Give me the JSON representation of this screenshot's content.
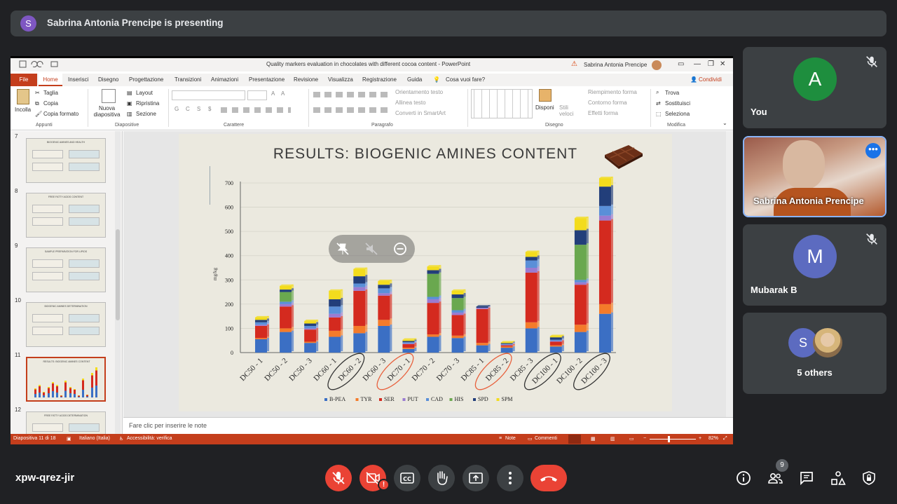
{
  "banner": {
    "avatar_letter": "S",
    "text": "Sabrina Antonia Prencipe is presenting"
  },
  "ppt": {
    "window_title": "Quality markers evaluation in chocolates with different cocoa content - PowerPoint",
    "user_name": "Sabrina Antonia Prencipe",
    "tabs": [
      "File",
      "Home",
      "Inserisci",
      "Disegno",
      "Progettazione",
      "Transizioni",
      "Animazioni",
      "Presentazione",
      "Revisione",
      "Visualizza",
      "Registrazione",
      "Guida"
    ],
    "tell_me": "Cosa vuoi fare?",
    "share": "Condividi",
    "ribbon": {
      "paste": "Incolla",
      "cut": "Taglia",
      "copy": "Copia",
      "format_painter": "Copia formato",
      "new_slide": "Nuova diapositiva",
      "layout": "Layout",
      "reset": "Ripristina",
      "section": "Sezione",
      "text_direction": "Orientamento testo",
      "align_text": "Allinea testo",
      "smartart": "Converti in SmartArt",
      "arrange": "Disponi",
      "quick_styles": "Stili veloci",
      "shape_fill": "Riempimento forma",
      "shape_outline": "Contorno forma",
      "shape_effects": "Effetti forma",
      "find": "Trova",
      "replace": "Sostituisci",
      "select": "Seleziona",
      "groups": {
        "clipboard": "Appunti",
        "slides": "Diapositive",
        "font": "Carattere",
        "paragraph": "Paragrafo",
        "drawing": "Disegno",
        "editing": "Modifica"
      },
      "font_buttons": [
        "G",
        "C",
        "S",
        "$"
      ]
    },
    "thumbnails": [
      {
        "num": "7",
        "title": "BIOGENIC AMINES AND HEALTH"
      },
      {
        "num": "8",
        "title": "FREE FATTY ACIDS CONTENT"
      },
      {
        "num": "9",
        "title": "SAMPLE PREPARATION FOR LIPIDS"
      },
      {
        "num": "10",
        "title": "BIOGENIC AMINES DETERMINATION"
      },
      {
        "num": "11",
        "title": "RESULTS: BIOGENIC AMINES CONTENT"
      },
      {
        "num": "12",
        "title": "FREE FATTY ACIDS DETERMINATION"
      }
    ],
    "notes_placeholder": "Fare clic per inserire le note",
    "status": {
      "slide": "Diapositiva 11 di 18",
      "language": "Italiano (Italia)",
      "accessibility": "Accessibilità: verifica",
      "notes": "Note",
      "comments": "Commenti",
      "zoom": "82%"
    }
  },
  "chart_data": {
    "type": "bar",
    "stacked": true,
    "title": "RESULTS: BIOGENIC AMINES CONTENT",
    "ylabel": "mg/kg",
    "ylim": [
      0,
      700
    ],
    "yticks": [
      0,
      100,
      200,
      300,
      400,
      500,
      600,
      700
    ],
    "categories": [
      "DC50 - 1",
      "DC50 - 2",
      "DC50 - 3",
      "DC60 - 1",
      "DC60 - 2",
      "DC60 - 3",
      "DC70 - 1",
      "DC70 - 2",
      "DC70 - 3",
      "DC85 - 1",
      "DC85 - 2",
      "DC85 - 3",
      "DC100 - 1",
      "DC100 - 2",
      "DC100 - 3"
    ],
    "circled": {
      "DC60 - 2": "#333333",
      "DC70 - 1": "#e8603c",
      "DC85 - 2": "#e8603c",
      "DC100 - 1": "#333333",
      "DC100 - 3": "#333333"
    },
    "series": [
      {
        "name": "B-PEA",
        "color": "#3b6fc4",
        "values": [
          55,
          85,
          40,
          65,
          80,
          110,
          15,
          65,
          60,
          30,
          20,
          100,
          25,
          85,
          160
        ]
      },
      {
        "name": "TYR",
        "color": "#f47b2a",
        "values": [
          5,
          15,
          5,
          25,
          30,
          25,
          5,
          10,
          10,
          10,
          5,
          25,
          5,
          30,
          40
        ]
      },
      {
        "name": "SER",
        "color": "#d42a1f",
        "values": [
          50,
          90,
          50,
          55,
          145,
          100,
          15,
          130,
          85,
          140,
          5,
          205,
          15,
          165,
          345
        ]
      },
      {
        "name": "PUT",
        "color": "#9a7bd1",
        "values": [
          5,
          10,
          5,
          15,
          15,
          10,
          3,
          15,
          10,
          5,
          3,
          20,
          3,
          10,
          20
        ]
      },
      {
        "name": "CAD",
        "color": "#5a8fd8",
        "values": [
          10,
          10,
          10,
          30,
          15,
          20,
          5,
          10,
          10,
          0,
          3,
          30,
          5,
          10,
          40
        ]
      },
      {
        "name": "HIS",
        "color": "#6aa84f",
        "values": [
          0,
          40,
          0,
          0,
          0,
          0,
          0,
          95,
          50,
          0,
          0,
          0,
          0,
          145,
          0
        ]
      },
      {
        "name": "SPD",
        "color": "#223e7a",
        "values": [
          10,
          10,
          10,
          30,
          30,
          15,
          5,
          15,
          15,
          5,
          3,
          15,
          10,
          60,
          80
        ]
      },
      {
        "name": "SPM",
        "color": "#f3dc1d",
        "values": [
          10,
          15,
          10,
          35,
          30,
          15,
          5,
          15,
          15,
          0,
          3,
          20,
          5,
          50,
          35
        ]
      }
    ]
  },
  "tiles": [
    {
      "name": "You",
      "letter": "A",
      "color": "#1e8e3e",
      "muted": true
    },
    {
      "name": "Sabrina Antonia Prencipe",
      "video": true
    },
    {
      "name": "Mubarak B",
      "letter": "M",
      "color": "#5c6bc0",
      "muted": true
    },
    {
      "name": "5 others",
      "letter": "S",
      "color": "#5c6bc0"
    }
  ],
  "bottom": {
    "meeting_code": "xpw-qrez-jir",
    "participants_count": "9"
  },
  "icons": {
    "mic_off": "mic-off-icon",
    "cam_off": "camera-off-icon",
    "captions": "captions-icon",
    "hand": "raise-hand-icon",
    "present": "present-icon",
    "more": "more-icon",
    "hangup": "hangup-icon",
    "info": "info-icon",
    "people": "people-icon",
    "chat": "chat-icon",
    "activities": "activities-icon",
    "lock": "host-controls-icon"
  }
}
